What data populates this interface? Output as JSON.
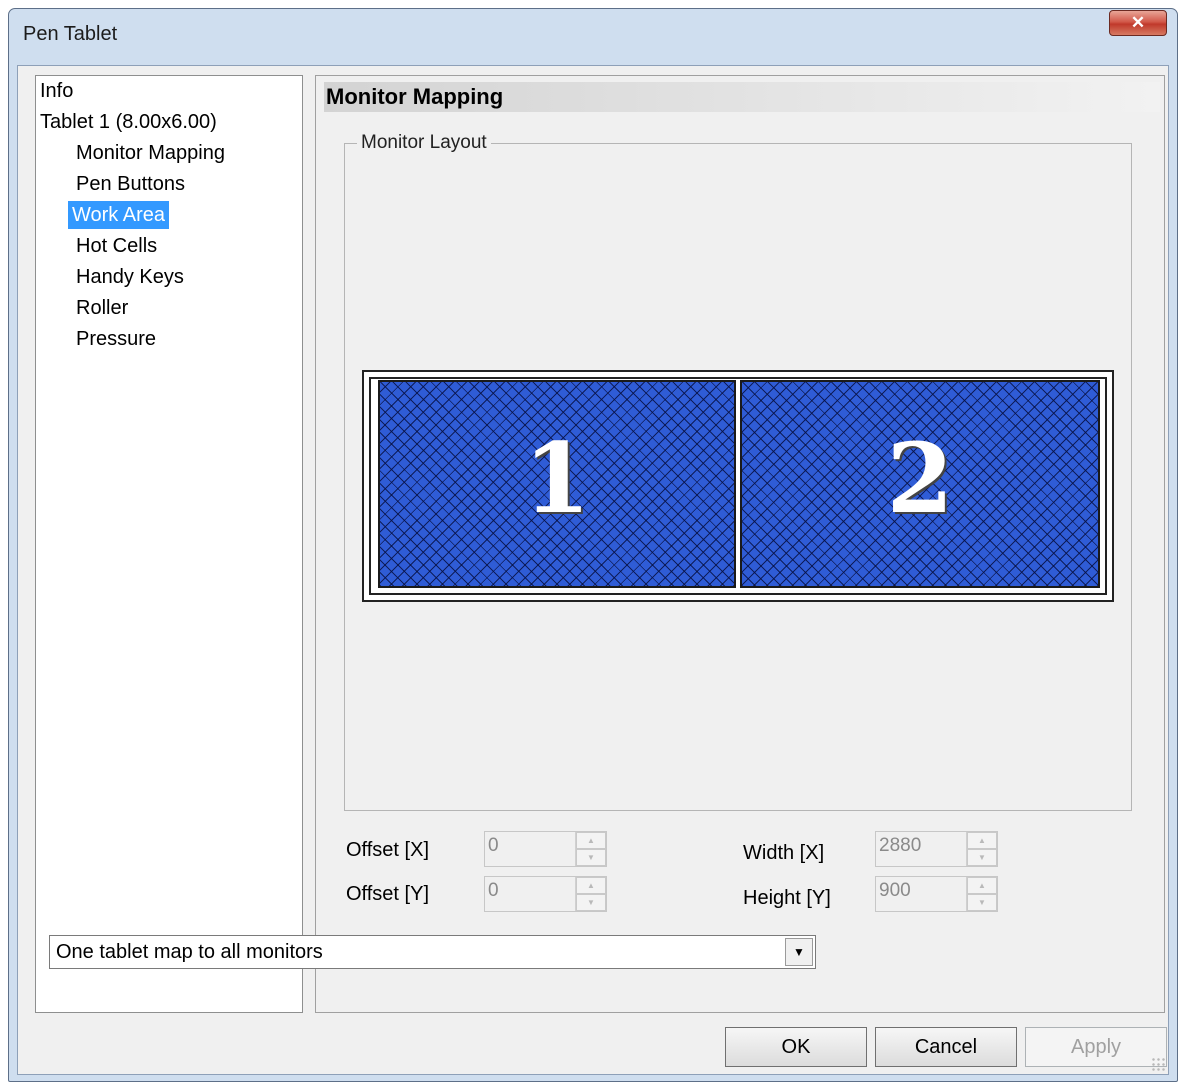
{
  "window": {
    "title": "Pen Tablet",
    "close_symbol": "✕",
    "accent": "#c0392b"
  },
  "tree": {
    "items": [
      {
        "label": "Info"
      },
      {
        "label": "Tablet  1 (8.00x6.00)"
      },
      {
        "label": "Monitor Mapping"
      },
      {
        "label": "Pen Buttons"
      },
      {
        "label": "Work Area",
        "selected": true
      },
      {
        "label": "Hot Cells"
      },
      {
        "label": "Handy Keys"
      },
      {
        "label": "Roller"
      },
      {
        "label": "Pressure"
      }
    ],
    "selection_color": "#3399ff"
  },
  "page": {
    "header": "Monitor Mapping",
    "group_label": "Monitor Layout",
    "monitors": [
      {
        "number": "1",
        "color": "#2f5cd6"
      },
      {
        "number": "2",
        "color": "#2f5cd6"
      }
    ],
    "offset_x": {
      "label": "Offset [X]",
      "value": "0"
    },
    "offset_y": {
      "label": "Offset [Y]",
      "value": "0"
    },
    "width_x": {
      "label": "Width [X]",
      "value": "2880"
    },
    "height_y": {
      "label": "Height [Y]",
      "value": "900"
    },
    "mapping_mode": {
      "selected": "One tablet map to all monitors"
    }
  },
  "buttons": {
    "ok": "OK",
    "cancel": "Cancel",
    "apply": "Apply"
  }
}
